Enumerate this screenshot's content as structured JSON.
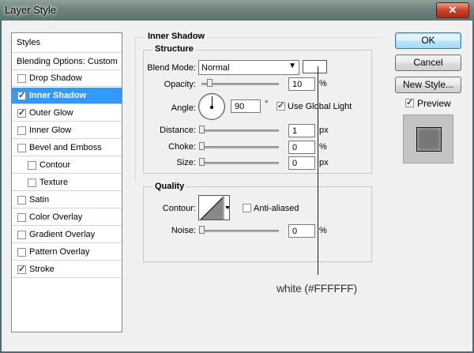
{
  "window": {
    "title": "Layer Style"
  },
  "left_list": {
    "header": "Styles",
    "blending": "Blending Options: Custom",
    "items": [
      {
        "label": "Drop Shadow",
        "checked": false
      },
      {
        "label": "Inner Shadow",
        "checked": true,
        "selected": true
      },
      {
        "label": "Outer Glow",
        "checked": true
      },
      {
        "label": "Inner Glow",
        "checked": false
      },
      {
        "label": "Bevel and Emboss",
        "checked": false
      },
      {
        "label": "Contour",
        "checked": false
      },
      {
        "label": "Texture",
        "checked": false
      },
      {
        "label": "Satin",
        "checked": false
      },
      {
        "label": "Color Overlay",
        "checked": false
      },
      {
        "label": "Gradient Overlay",
        "checked": false
      },
      {
        "label": "Pattern Overlay",
        "checked": false
      },
      {
        "label": "Stroke",
        "checked": true
      }
    ]
  },
  "inner_shadow": {
    "title": "Inner Shadow",
    "structure": {
      "title": "Structure",
      "blend_mode_label": "Blend Mode:",
      "blend_mode_value": "Normal",
      "blend_color": "#FFFFFF",
      "opacity_label": "Opacity:",
      "opacity_value": "10",
      "opacity_unit": "%",
      "angle_label": "Angle:",
      "angle_value": "90",
      "angle_unit": "°",
      "global_light_label": "Use Global Light",
      "global_light_checked": true,
      "distance_label": "Distance:",
      "distance_value": "1",
      "distance_unit": "px",
      "choke_label": "Choke:",
      "choke_value": "0",
      "choke_unit": "%",
      "size_label": "Size:",
      "size_value": "0",
      "size_unit": "px"
    },
    "quality": {
      "title": "Quality",
      "contour_label": "Contour:",
      "anti_aliased_label": "Anti-aliased",
      "anti_aliased_checked": false,
      "noise_label": "Noise:",
      "noise_value": "0",
      "noise_unit": "%"
    }
  },
  "buttons": {
    "ok": "OK",
    "cancel": "Cancel",
    "new_style": "New Style...",
    "preview_label": "Preview",
    "preview_checked": true
  },
  "callout": {
    "text": "white (#FFFFFF)"
  },
  "icons": {
    "close": "close-icon",
    "dropdown": "chevron-down-icon",
    "check": "checkmark-icon"
  }
}
